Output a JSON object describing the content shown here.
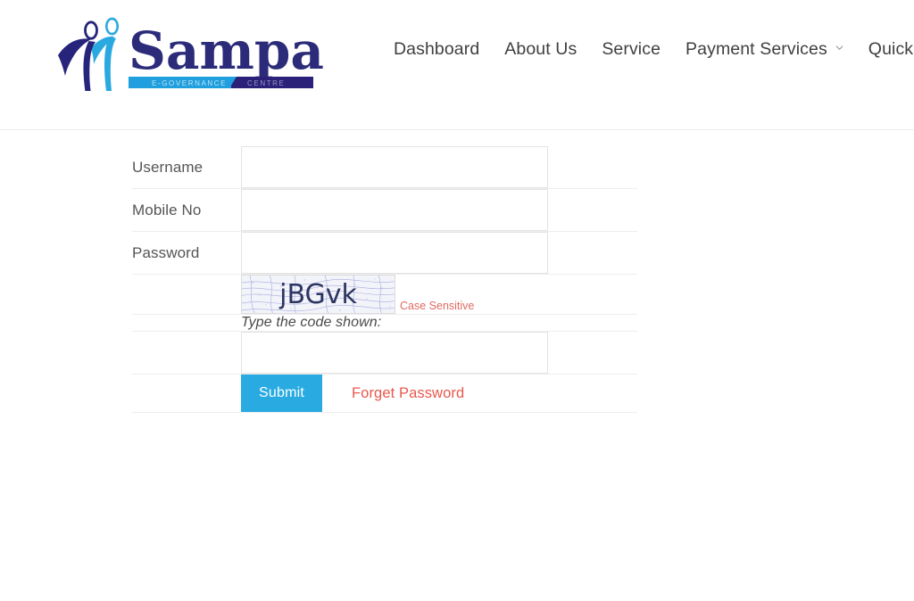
{
  "header": {
    "logo": {
      "name": "Sampark",
      "wordmark": "Sampark",
      "banner_left": "E-GOVERNANCE",
      "banner_right": "CENTRE",
      "colors": {
        "wordmark": "#2b2b7a",
        "figure_dark": "#26247b",
        "figure_light": "#2aa9e0",
        "banner_left_bg": "#1f9fdd",
        "banner_right_bg": "#2b2178"
      }
    },
    "nav": [
      {
        "label": "Dashboard",
        "has_dropdown": false
      },
      {
        "label": "About Us",
        "has_dropdown": false
      },
      {
        "label": "Service",
        "has_dropdown": false
      },
      {
        "label": "Payment Services",
        "has_dropdown": true
      },
      {
        "label": "Quick Pay",
        "has_dropdown": true
      }
    ]
  },
  "login_form": {
    "fields": [
      {
        "label": "Username",
        "value": "",
        "placeholder": ""
      },
      {
        "label": "Mobile No",
        "value": "",
        "placeholder": ""
      },
      {
        "label": "Password",
        "value": "",
        "placeholder": ""
      }
    ],
    "captcha": {
      "code": "jBGvk",
      "note": "Case Sensitive",
      "note_color": "#e06a63",
      "text_color": "#2b3560",
      "background_color": "#f5f5fb"
    },
    "code_hint": "Type the code shown:",
    "captcha_answer": {
      "value": "",
      "placeholder": ""
    },
    "submit_label": "Submit",
    "submit_color": "#29ABE2",
    "forget_password_label": "Forget Password",
    "forget_password_color": "#e8594e"
  }
}
